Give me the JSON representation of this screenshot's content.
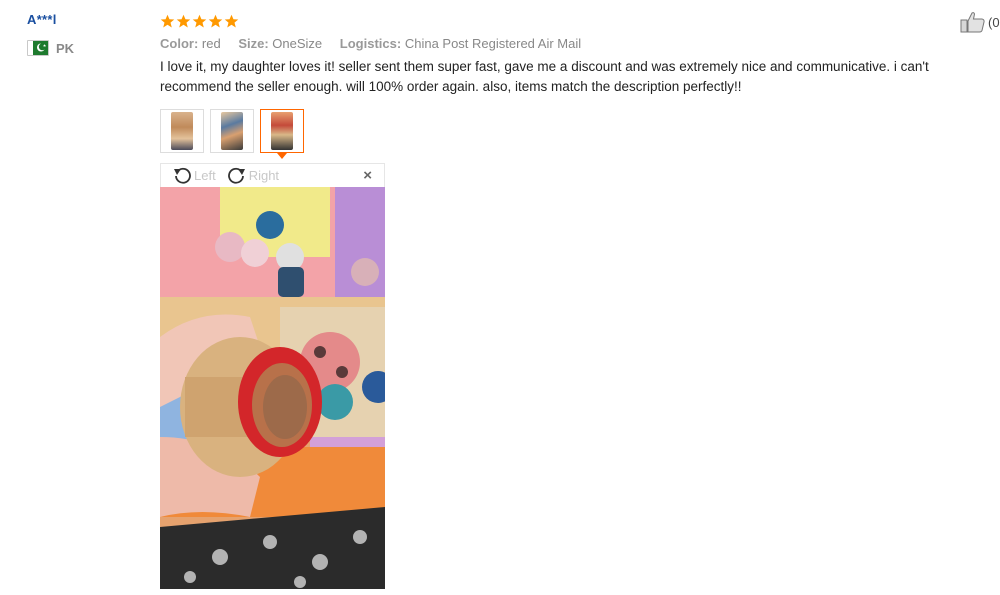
{
  "user": {
    "name": "A***l",
    "country_code": "PK",
    "flag_icon": "pakistan-flag-icon"
  },
  "review": {
    "rating": 5,
    "rating_max": 5,
    "star_color": "#ff9900",
    "attributes": [
      {
        "label": "Color:",
        "value": "red"
      },
      {
        "label": "Size:",
        "value": "OneSize"
      },
      {
        "label": "Logistics:",
        "value": "China Post Registered Air Mail"
      }
    ],
    "text": "I love it, my daughter loves it! seller sent them super fast, gave me a discount and was extremely nice and communicative. i can't recommend the seller enough. will 100% order again. also, items match the description perfectly!!",
    "helpful_count": "(0"
  },
  "thumbnails": [
    {
      "name": "thumbnail-1",
      "active": false
    },
    {
      "name": "thumbnail-2",
      "active": false
    },
    {
      "name": "thumbnail-3",
      "active": true
    }
  ],
  "viewer": {
    "rotate_left_label": "Left",
    "rotate_right_label": "Right",
    "close_label": "×"
  },
  "colors": {
    "accent": "#ff6600",
    "username": "#1a4fa0"
  }
}
